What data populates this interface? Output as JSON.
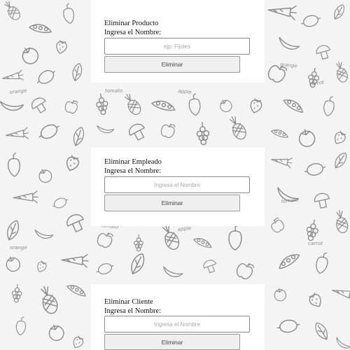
{
  "forms": [
    {
      "title": "Eliminar Producto",
      "label": "Ingresa el Nombre:",
      "input_value": "",
      "placeholder": "ejp: Fijoles",
      "button_label": "Eliminar"
    },
    {
      "title": "Eliminar Empleado",
      "label": "Ingresa el Nombre:",
      "input_value": "",
      "placeholder": "Ingresa el Nombre",
      "button_label": "Eliminar"
    },
    {
      "title": "Eliminar Cliente",
      "label": "Ingresa el Nombre:",
      "input_value": "",
      "placeholder": "Ingresa el Nombre",
      "button_label": "Eliminar"
    }
  ],
  "background": {
    "pattern": "hand-drawn fruits and vegetables doodle",
    "doodle_words": [
      "orange",
      "tomato",
      "apple",
      "carrot"
    ],
    "colors": {
      "base": "#f4f4f4",
      "ink": "#8c8c8c",
      "card": "#ffffff"
    }
  }
}
